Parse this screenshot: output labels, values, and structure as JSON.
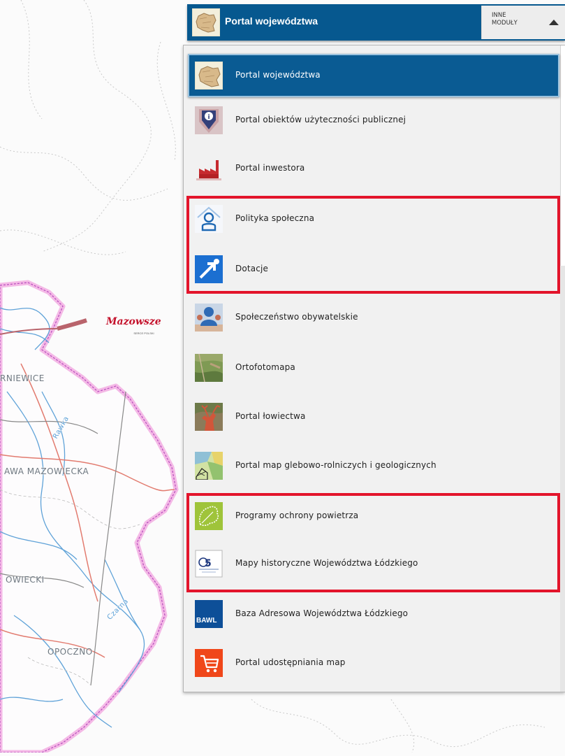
{
  "header": {
    "title": "Portal województwa",
    "other_modules_label": "INNE\nMODUŁY",
    "thumb_icon": "province-map-icon",
    "arrow_icon": "triangle-up-icon"
  },
  "modules": [
    {
      "label": "Portal województwa",
      "icon": "province-map-icon",
      "selected": true
    },
    {
      "label": "Portal obiektów użyteczności publicznej",
      "icon": "info-pin-icon"
    },
    {
      "label": "Portal inwestora",
      "icon": "factory-icon"
    },
    {
      "label": "Polityka społeczna",
      "icon": "person-house-icon"
    },
    {
      "label": "Dotacje",
      "icon": "arrow-up-right-icon"
    },
    {
      "label": "Społeczeństwo obywatelskie",
      "icon": "people-icon"
    },
    {
      "label": "Ortofotomapa",
      "icon": "aerial-photo-icon"
    },
    {
      "label": "Portal łowiectwa",
      "icon": "deer-icon"
    },
    {
      "label": "Portal map glebowo-rolniczych i geologicznych",
      "icon": "soil-map-icon"
    },
    {
      "label": "Programy ochrony powietrza",
      "icon": "leaf-icon"
    },
    {
      "label": "Mapy historyczne Województwa Łódzkiego",
      "icon": "historical-map-icon"
    },
    {
      "label": "Baza Adresowa Województwa Łódzkiego",
      "icon": "bawl-logo-icon",
      "icon_text": "BAWL"
    },
    {
      "label": "Portal udostępniania map",
      "icon": "shopping-cart-icon"
    }
  ],
  "map": {
    "logo_text": "Mazowsze",
    "logo_subtext": "SERCE POLSKI",
    "place_labels": [
      "RNIEWICE",
      "AWA MAZOWIECKA",
      "OWIECKI",
      "OPOCZNO",
      "Rawka",
      "Czarna"
    ]
  },
  "colors": {
    "header_blue": "#06588f",
    "highlight_red": "#e3142b",
    "panel_bg": "#f1f1f1",
    "region_border": "#f4b9e6"
  }
}
